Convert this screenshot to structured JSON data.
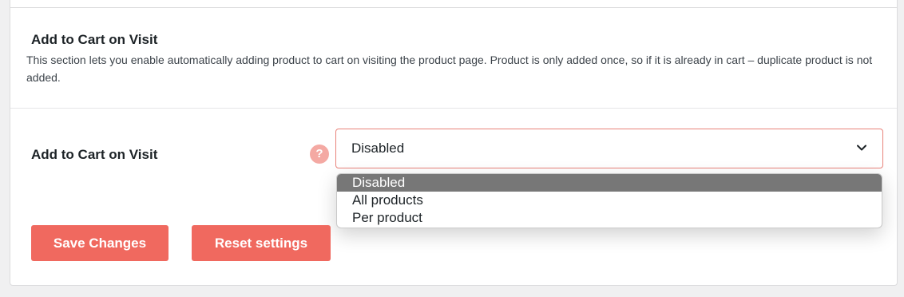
{
  "section": {
    "title": "Add to Cart on Visit",
    "description": "This section lets you enable automatically adding product to cart on visiting the product page. Product is only added once, so if it is already in cart – duplicate product is not added."
  },
  "field": {
    "label": "Add to Cart on Visit",
    "help_icon_glyph": "?",
    "help_icon_name": "question-mark-icon",
    "selected_value": "Disabled",
    "options": [
      "Disabled",
      "All products",
      "Per product"
    ]
  },
  "buttons": {
    "save_label": "Save Changes",
    "reset_label": "Reset settings"
  },
  "colors": {
    "accent": "#f0695f",
    "help_icon": "#f4a9a3",
    "select_border": "#e8827a",
    "option_highlight": "#777777"
  }
}
